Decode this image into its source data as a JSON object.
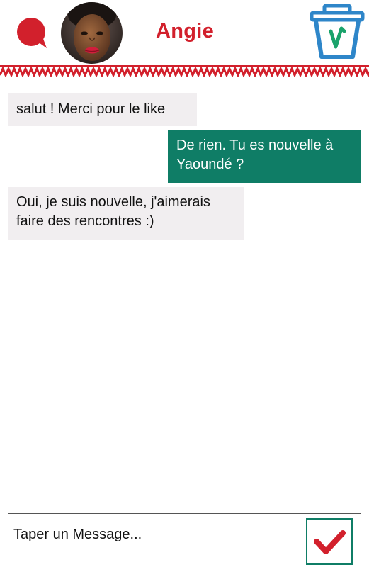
{
  "header": {
    "contact_name": "Angie",
    "chat_icon": "speech-bubble-icon",
    "avatar": "contact-avatar-photo",
    "trash_icon": "trash-icon"
  },
  "messages": [
    {
      "direction": "incoming",
      "text": "salut ! Merci pour le like"
    },
    {
      "direction": "outgoing",
      "text": "De rien. Tu es nouvelle à Yaoundé ?"
    },
    {
      "direction": "incoming",
      "text": "Oui, je suis nouvelle, j'aimerais faire des rencontres :)"
    }
  ],
  "composer": {
    "placeholder": "Taper un Message...",
    "value": "",
    "send_icon": "checkmark-icon"
  },
  "colors": {
    "brand_red": "#d2202c",
    "outgoing_bubble": "#0f7d66",
    "incoming_bubble": "#f1eef0",
    "trash_blue": "#2e86c9"
  }
}
